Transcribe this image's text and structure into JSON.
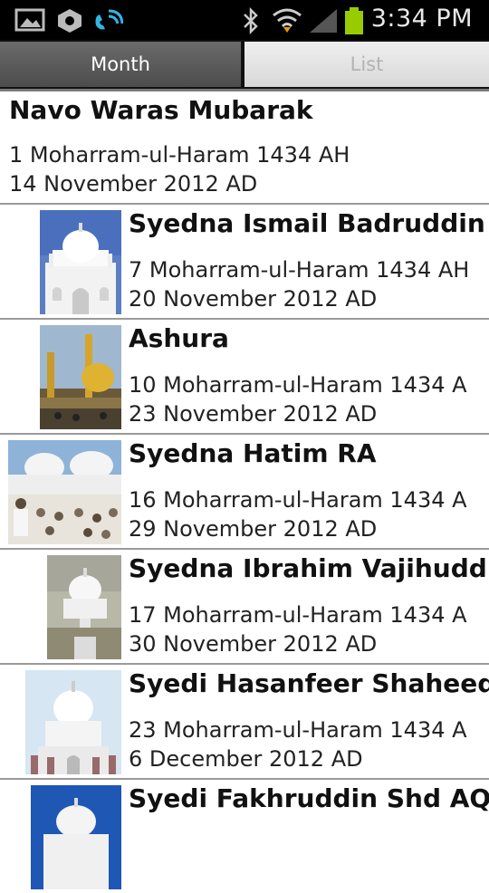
{
  "status_bar": {
    "time": "3:34 PM",
    "icons": [
      "gallery-icon",
      "shield-icon",
      "wifi-call-icon",
      "bluetooth-icon",
      "wifi-icon",
      "signal-icon",
      "battery-icon"
    ]
  },
  "tabs": [
    {
      "label": "Month",
      "selected": true
    },
    {
      "label": "List",
      "selected": false
    }
  ],
  "colors": {
    "status_bar": "#000000",
    "active_tab": "#5a5a5a",
    "inactive_tab": "#e3e3e3",
    "divider": "#9a9a9a"
  },
  "events": [
    {
      "title": "Navo Waras Mubarak",
      "hijri": "1 Moharram-ul-Haram 1434 AH",
      "gregorian": "14 November 2012 AD"
    },
    {
      "title": "Syedna Ismail Badruddin RA",
      "hijri": "7 Moharram-ul-Haram 1434 AH",
      "gregorian": "20 November 2012 AD"
    },
    {
      "title": "Ashura",
      "hijri": "10 Moharram-ul-Haram 1434 A",
      "gregorian": "23 November 2012 AD"
    },
    {
      "title": "Syedna Hatim RA",
      "hijri": "16 Moharram-ul-Haram 1434 A",
      "gregorian": "29 November 2012 AD"
    },
    {
      "title": "Syedna Ibrahim Vajihuddin",
      "hijri": "17 Moharram-ul-Haram 1434 A",
      "gregorian": "30 November 2012 AD"
    },
    {
      "title": "Syedi Hasanfeer Shaheed A",
      "hijri": "23 Moharram-ul-Haram 1434 A",
      "gregorian": "6 December 2012 AD"
    },
    {
      "title": "Syedi Fakhruddin Shd AQ",
      "hijri": "",
      "gregorian": ""
    }
  ]
}
